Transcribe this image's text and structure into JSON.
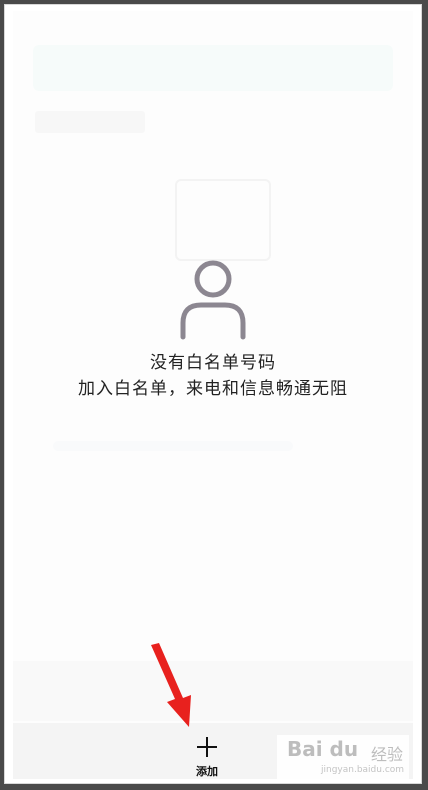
{
  "empty_state": {
    "icon": "person-outline-icon",
    "title": "没有白名单号码",
    "subtitle": "加入白名单，来电和信息畅通无阻"
  },
  "bottom_bar": {
    "add_icon": "plus-icon",
    "add_label": "添加"
  },
  "annotation": {
    "arrow_color": "#e8211e"
  },
  "watermark": {
    "logo_text": "Bai du",
    "cn_text": "经验",
    "url": "jingyan.baidu.com"
  },
  "colors": {
    "background": "#fdfdfd",
    "icon_gray": "#8c8791",
    "text": "#222222",
    "bottom_bar": "#f4f4f4"
  }
}
